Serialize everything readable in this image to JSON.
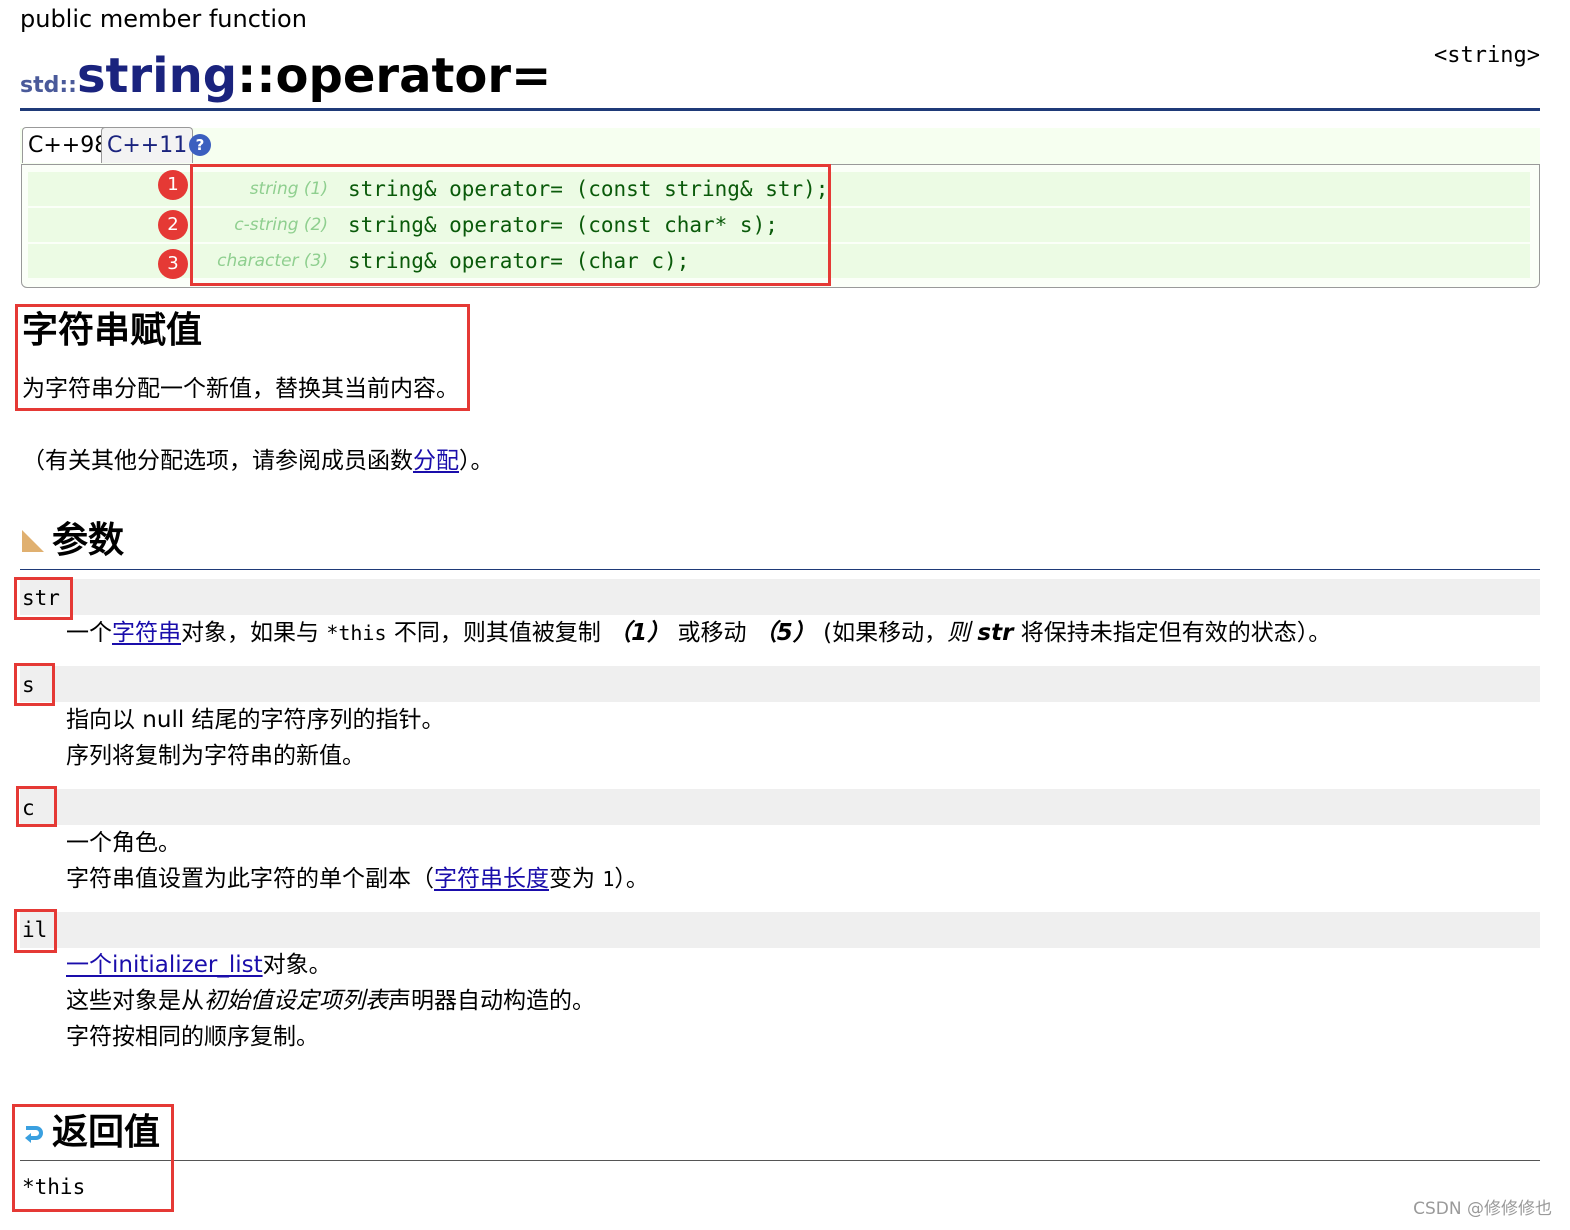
{
  "page": {
    "kind": "public member function",
    "title_ns": "std::",
    "title_class": "string",
    "title_op": "::operator=",
    "header": "<string>"
  },
  "versions": {
    "tab1": "C++98",
    "tab2": "C++11",
    "help_glyph": "?"
  },
  "prototypes": [
    {
      "badge": "1",
      "label": "string (1)",
      "code": "string& operator= (const string& str);"
    },
    {
      "badge": "2",
      "label": "c-string (2)",
      "code": "string& operator= (const char* s);"
    },
    {
      "badge": "3",
      "label": "character (3)",
      "code": "string& operator= (char c);"
    }
  ],
  "description": {
    "title": "字符串赋值",
    "text": "为字符串分配一个新值，替换其当前内容。",
    "note_before": "（有关其他分配选项，请参阅成员函数",
    "note_link": "分配",
    "note_after": "）。"
  },
  "parameters": {
    "title": "参数",
    "str": {
      "name": "str",
      "p1": "一个",
      "link": "字符串",
      "p2": "对象，如果与",
      "code": "*this",
      "p3": "不同，则其值被复制",
      "n1": "（1）",
      "p4": "或移动",
      "n2": "（5）",
      "p5": "(如果移动，",
      "p5i": "则",
      "p6": "str",
      "p7": "将保持未指定但有效的状态）。"
    },
    "s": {
      "name": "s",
      "line1": "指向以 null 结尾的字符序列的指针。",
      "line2": "序列将复制为字符串的新值。"
    },
    "c": {
      "name": "c",
      "line1": "一个角色。",
      "line2_a": "字符串值设置为此字符的单个副本（",
      "line2_link": "字符串长度",
      "line2_b": "变为",
      "line2_code": "1",
      "line2_c": "）。"
    },
    "il": {
      "name": "il",
      "link": "一个initializer_list",
      "line1_after": "对象。",
      "line2_a": "这些对象是从",
      "line2_i": "初始值设定项列表",
      "line2_b": "声明器自动构造的。",
      "line3": "字符按相同的顺序复制。"
    }
  },
  "return": {
    "title": "返回值",
    "value": "*this"
  },
  "watermark": "CSDN @修修修也",
  "colors": {
    "accent_red": "#e53935",
    "title_blue": "#1a237e",
    "code_green": "#0a5a0a",
    "link": "#1a0dab"
  }
}
